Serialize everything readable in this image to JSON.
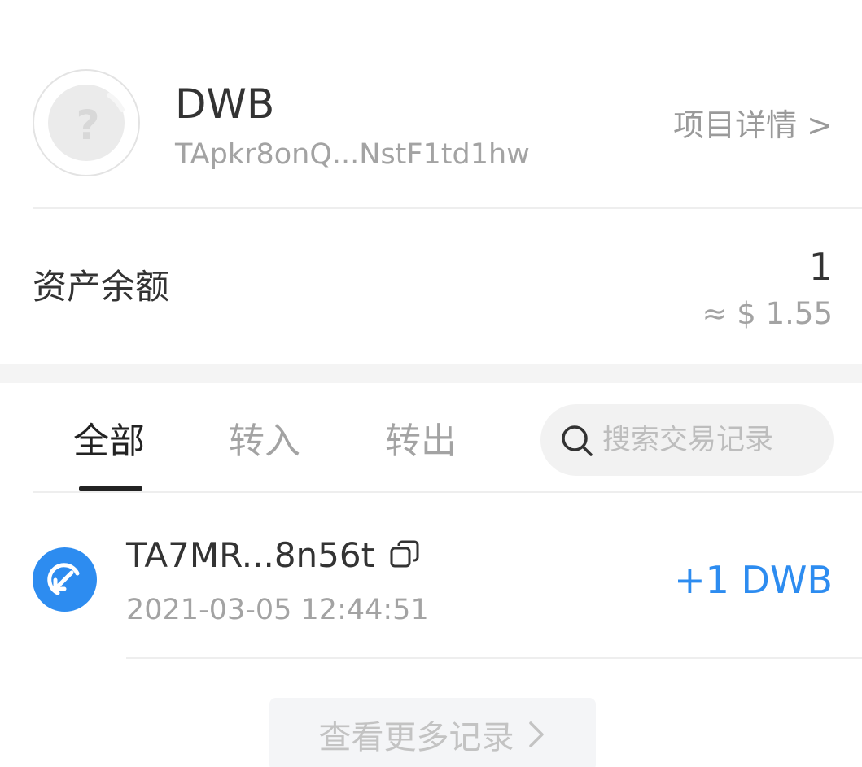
{
  "token": {
    "name": "DWB",
    "address": "TApkr8onQ...NstF1td1hw",
    "detail_link": "项目详情 >",
    "avatar_glyph": "?"
  },
  "balance": {
    "label": "资产余额",
    "amount": "1",
    "usd_value": "≈ $ 1.55"
  },
  "tabs": [
    {
      "label": "全部",
      "active": true
    },
    {
      "label": "转入",
      "active": false
    },
    {
      "label": "转出",
      "active": false
    }
  ],
  "search": {
    "placeholder": "搜索交易记录",
    "icon": "search-icon"
  },
  "transactions": [
    {
      "address": "TA7MR...8n56t",
      "time": "2021-03-05 12:44:51",
      "amount": "+1 DWB",
      "icon": "transfer-in-icon"
    }
  ],
  "more": {
    "label": "查看更多记录"
  },
  "colors": {
    "accent": "#2d8cf0",
    "text_primary": "#333333",
    "text_secondary": "#a3a3a3",
    "divider": "#eeeeee"
  }
}
